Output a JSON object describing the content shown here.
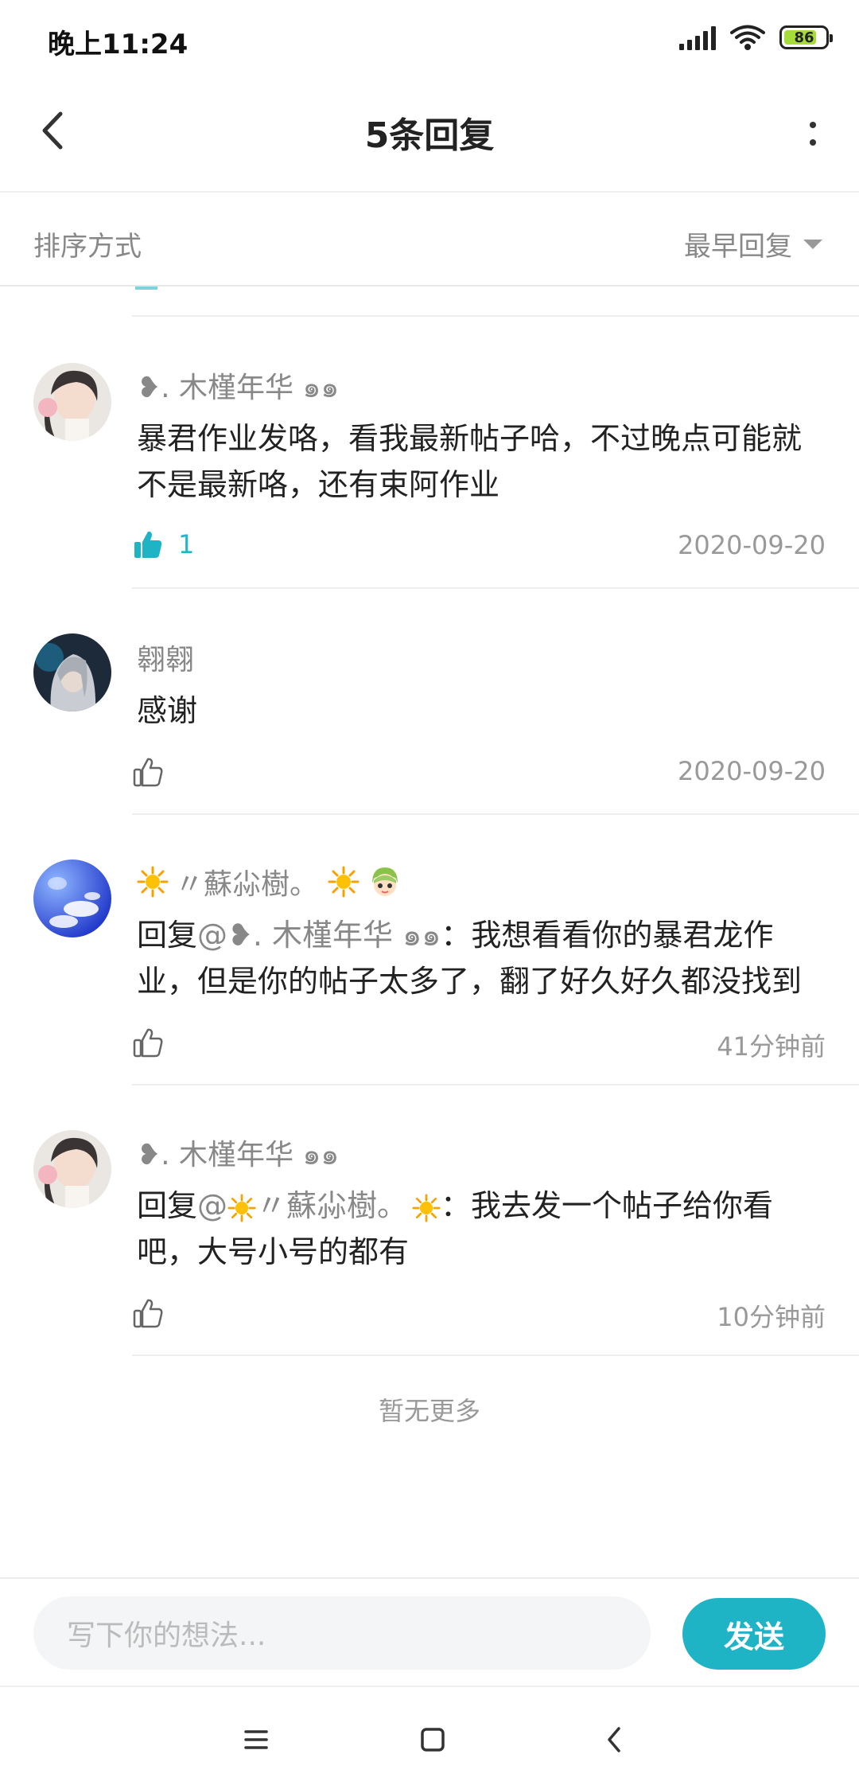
{
  "status_bar": {
    "time": "晚上11:24",
    "battery": "86",
    "icons": [
      "signal-icon",
      "wifi-icon",
      "battery-icon"
    ]
  },
  "header": {
    "title": "5条回复",
    "back_icon": "chevron-left-icon",
    "more_icon": "more-vertical-icon"
  },
  "sort": {
    "label": "排序方式",
    "selected": "最早回复"
  },
  "comments": [
    {
      "name": "❥. 木槿年华 ๑๑",
      "text": "暴君作业发咯，看我最新帖子哈，不过晚点可能就不是最新咯，还有束阿作业",
      "likes": "1",
      "liked": true,
      "time": "2020-09-20"
    },
    {
      "name": "翱翱",
      "text": "感谢",
      "likes": "",
      "liked": false,
      "time": "2020-09-20"
    },
    {
      "name": "〃蘇尛樹。",
      "text_prefix": "回复",
      "mention": "@❥. 木槿年华 ๑๑",
      "text_line1": "：我想看看你的暴君龙作",
      "text_line2": "业，但是你的帖子太多了，翻了好久好久都没找到",
      "likes": "",
      "liked": false,
      "time": "41分钟前"
    },
    {
      "name": "❥. 木槿年华 ๑๑",
      "text_prefix": "回复",
      "mention_at": "@",
      "mention_name": "〃蘇尛樹。",
      "text_line1": "：我去发一个帖子给你看",
      "text_line2": "吧，大号小号的都有",
      "likes": "",
      "liked": false,
      "time": "10分钟前"
    }
  ],
  "footer_note": "暂无更多",
  "input": {
    "placeholder": "写下你的想法...",
    "send_label": "发送"
  },
  "colors": {
    "accent": "#1fb3c6",
    "muted_text": "#888888",
    "divider": "#eeeeee"
  }
}
